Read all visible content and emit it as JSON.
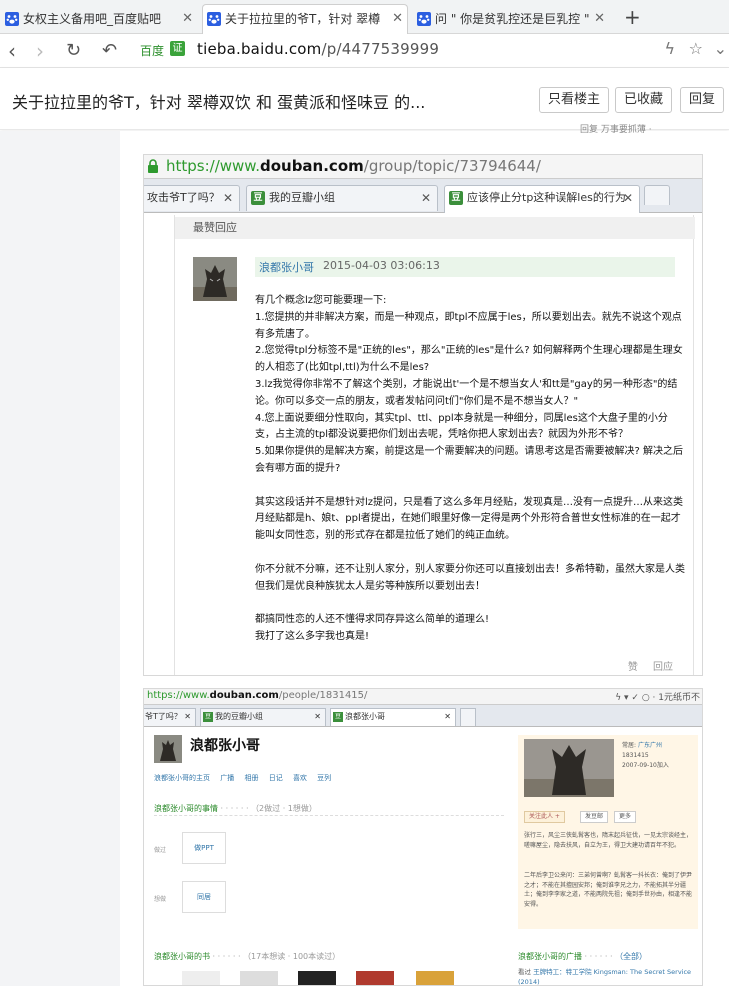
{
  "browser": {
    "tabs": [
      {
        "label": "女权主义备用吧_百度贴吧",
        "active": false
      },
      {
        "label": "关于拉拉里的爷T，针对 翠樽",
        "active": true
      },
      {
        "label": "问 \" 你是贫乳控还是巨乳控 \"",
        "active": false
      }
    ],
    "site_label": "百度",
    "cert_badge": "证",
    "url_host": "tieba.baidu.com",
    "url_path": "/p/4477539999"
  },
  "thread": {
    "title": "关于拉拉里的爷T，针对 翠樽双饮 和 蛋黄派和怪味豆 的...",
    "buttons": {
      "only_op": "只看楼主",
      "collected": "已收藏",
      "reply": "回复"
    },
    "peek_text": "回复 万事要抓薄 ·"
  },
  "screenshot1": {
    "url_scheme": "https://www.",
    "url_host": "douban.com",
    "url_path": "/group/topic/73794644/",
    "tabs": [
      {
        "label": "攻击爷T了吗？",
        "has_icon": false
      },
      {
        "label": "我的豆瓣小组",
        "has_icon": true
      },
      {
        "label": "应该停止分tp这种误解les的行为",
        "has_icon": true
      }
    ],
    "section_header": "最赞回应",
    "author": "浪都张小哥",
    "date": "2015-04-03 03:06:13",
    "paragraphs": [
      "有几个概念lz您可能要理一下:",
      "1.您提拱的并非解决方案，而是一种观点，即tpl不应属于les，所以要划出去。就先不说这个观点有多荒唐了。",
      "2.您觉得tpl分标签不是\"正统的les\"，那么\"正统的les\"是什么? 如何解释两个生理心理都是生理女的人相恋了(比如tpl,ttl)为什么不是les?",
      "3.lz我觉得你非常不了解这个类别，才能说出t'一个是不想当女人'和tt是\"gay的另一种形态\"的结论。你可以多交一点的朋友，或者发帖问问t们\"你们是不是不想当女人？\"",
      "4.您上面说要细分性取向，其实tpl、ttl、ppl本身就是一种细分，同属les这个大盘子里的小分支，占主流的tpl都没说要把你们划出去呢，凭啥你把人家划出去？就因为外形不爷？",
      "5.如果你提供的是解决方案，前提这是一个需要解决的问题。请思考这是否需要被解决? 解决之后会有哪方面的提升?",
      "",
      "其实这段话并不是想针对lz提问，只是看了这么多年月经贴，发现真是…没有一点提升…从来这类月经贴都是h、娘t、ppl者提出，在她们眼里好像一定得是两个外形符合普世女性标准的在一起才能叫女同性恋，别的形式存在都是拉低了她们的纯正血统。",
      "",
      "你不分就不分嘛，还不让别人家分，别人家要分你还可以直接划出去！多希特勒，虽然大家是人类但我们是优良种族犹太人是劣等种族所以要划出去！",
      "",
      "都搞同性恋的人还不懂得求同存异这么简单的道理么!",
      "我打了这么多字我也真是!"
    ],
    "actions": {
      "like": "赞",
      "reply": "回应"
    }
  },
  "screenshot2": {
    "url_scheme": "https://www.",
    "url_host": "douban.com",
    "url_path": "/people/1831415/",
    "right_text": "1元纸币不",
    "tabs": [
      {
        "label": "爷T了吗？",
        "has_icon": false
      },
      {
        "label": "我的豆瓣小组",
        "has_icon": true
      },
      {
        "label": "浪都张小哥",
        "has_icon": true
      }
    ],
    "name": "浪都张小哥",
    "nav": [
      "浪都张小哥的主页",
      "广播",
      "相册",
      "日记",
      "喜欢",
      "豆列"
    ],
    "things_header": "浪都张小哥的事情",
    "things_sub": "（2做过 · 1想做）",
    "did_label": "做过",
    "did_item": "做PPT",
    "want_label": "想做",
    "want_item": "同居",
    "books_header": "浪都张小哥的书",
    "books_sub": "（17本想读 · 100本读过）",
    "bcast_header": "浪都张小哥的广播",
    "bcast_all": "（全部）",
    "bcast_line_prefix": "看过",
    "bcast_line": "王牌特工：特工学院 Kingsman: The Secret Service (2014)",
    "side": {
      "city_label": "常居:",
      "city": "广东广州",
      "uid": "1831415",
      "joined": "2007-09-10加入",
      "follow_btn": "关注此人 +",
      "mail_btn": "发豆邮",
      "more_btn": "更多",
      "bio1": "张行三，风尘三侠虬髯客也，隋末起兵征伐，一见太宗谈经主，嗟嘛屋尘，隐去扶风，自立为王，得卫大建功请百年不犯。",
      "bio2": "二年后李卫公来问：三弟何曾啊？虬髯客一抖长衣：俺到了伊尹之才；不能在其擅园安邦；俺到谁李兄之力，不能拓其半分疆土；俺到李李家之道，不能两院先祖；俺到手世孙由，相逢不能安得。"
    }
  }
}
